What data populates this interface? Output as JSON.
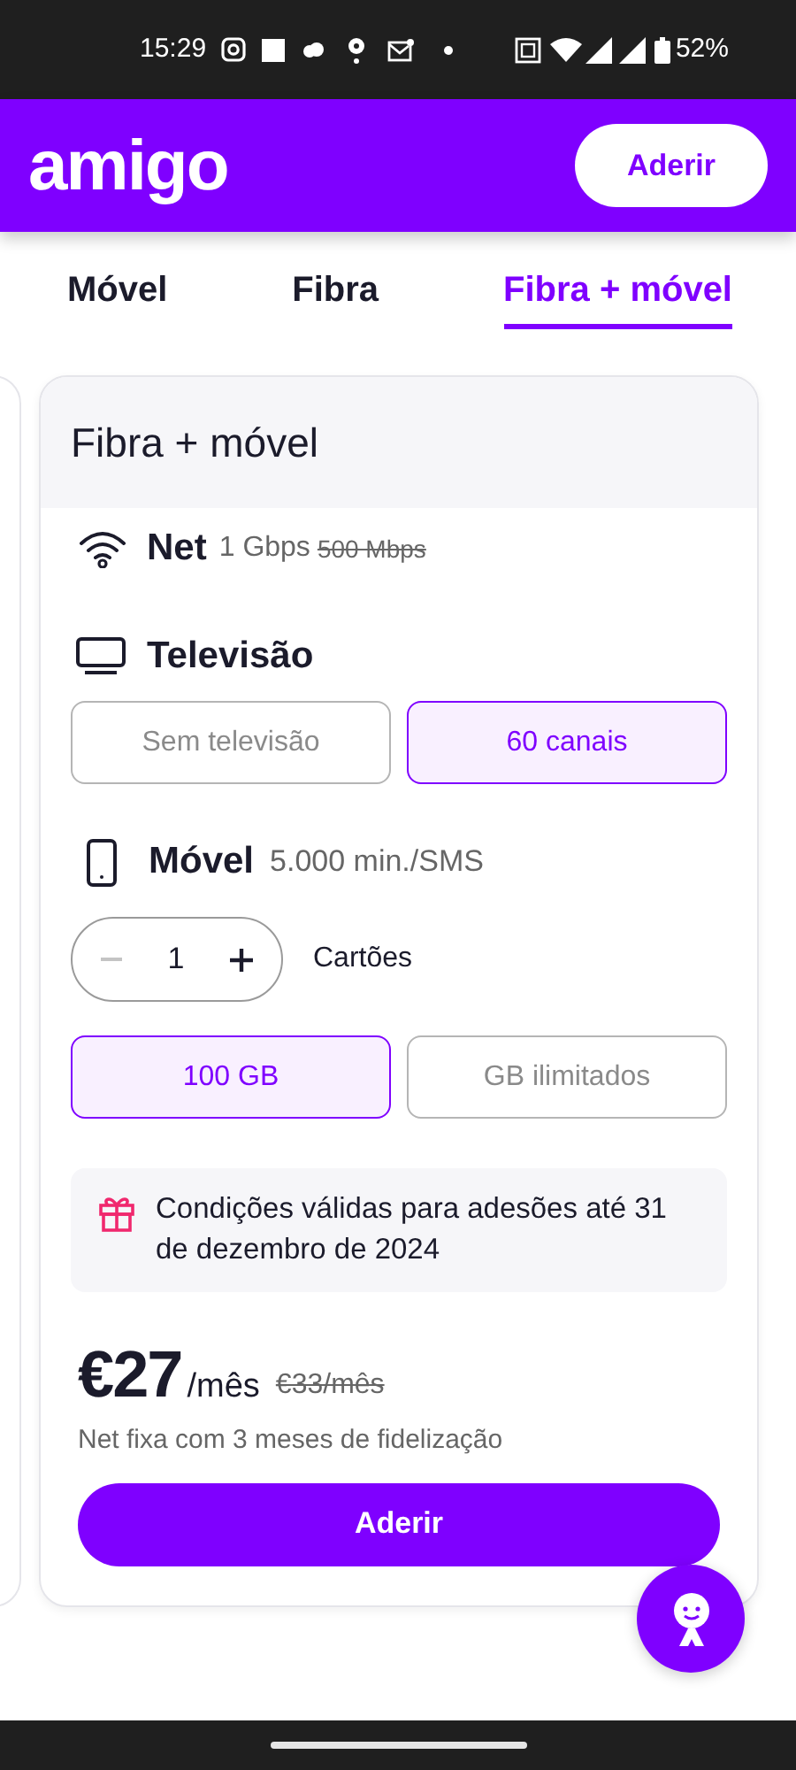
{
  "status_bar": {
    "time": "15:29",
    "battery": "52%"
  },
  "header": {
    "logo": "amigo",
    "button": "Aderir"
  },
  "tabs": [
    {
      "label": "Móvel",
      "selected": false
    },
    {
      "label": "Fibra",
      "selected": false
    },
    {
      "label": "Fibra + móvel",
      "selected": true
    }
  ],
  "plan": {
    "title": "Fibra + móvel",
    "net": {
      "label": "Net",
      "value": "1 Gbps",
      "old_value": "500 Mbps"
    },
    "tv": {
      "label": "Televisão",
      "options": [
        {
          "label": "Sem televisão",
          "selected": false
        },
        {
          "label": "60 canais",
          "selected": true
        }
      ]
    },
    "mobile": {
      "label": "Móvel",
      "value": "5.000 min./SMS",
      "quantity": "1",
      "decrement_disabled": true,
      "quantity_label": "Cartões",
      "options": [
        {
          "label": "100 GB",
          "selected": true
        },
        {
          "label": "GB ilimitados",
          "selected": false
        }
      ]
    },
    "notice": "Condições válidas para adesões até 31 de dezembro de 2024",
    "price": {
      "amount": "€27",
      "unit": "/mês",
      "old": "€33/mês"
    },
    "note": "Net fixa com 3 meses de fidelização",
    "button": "Aderir"
  }
}
